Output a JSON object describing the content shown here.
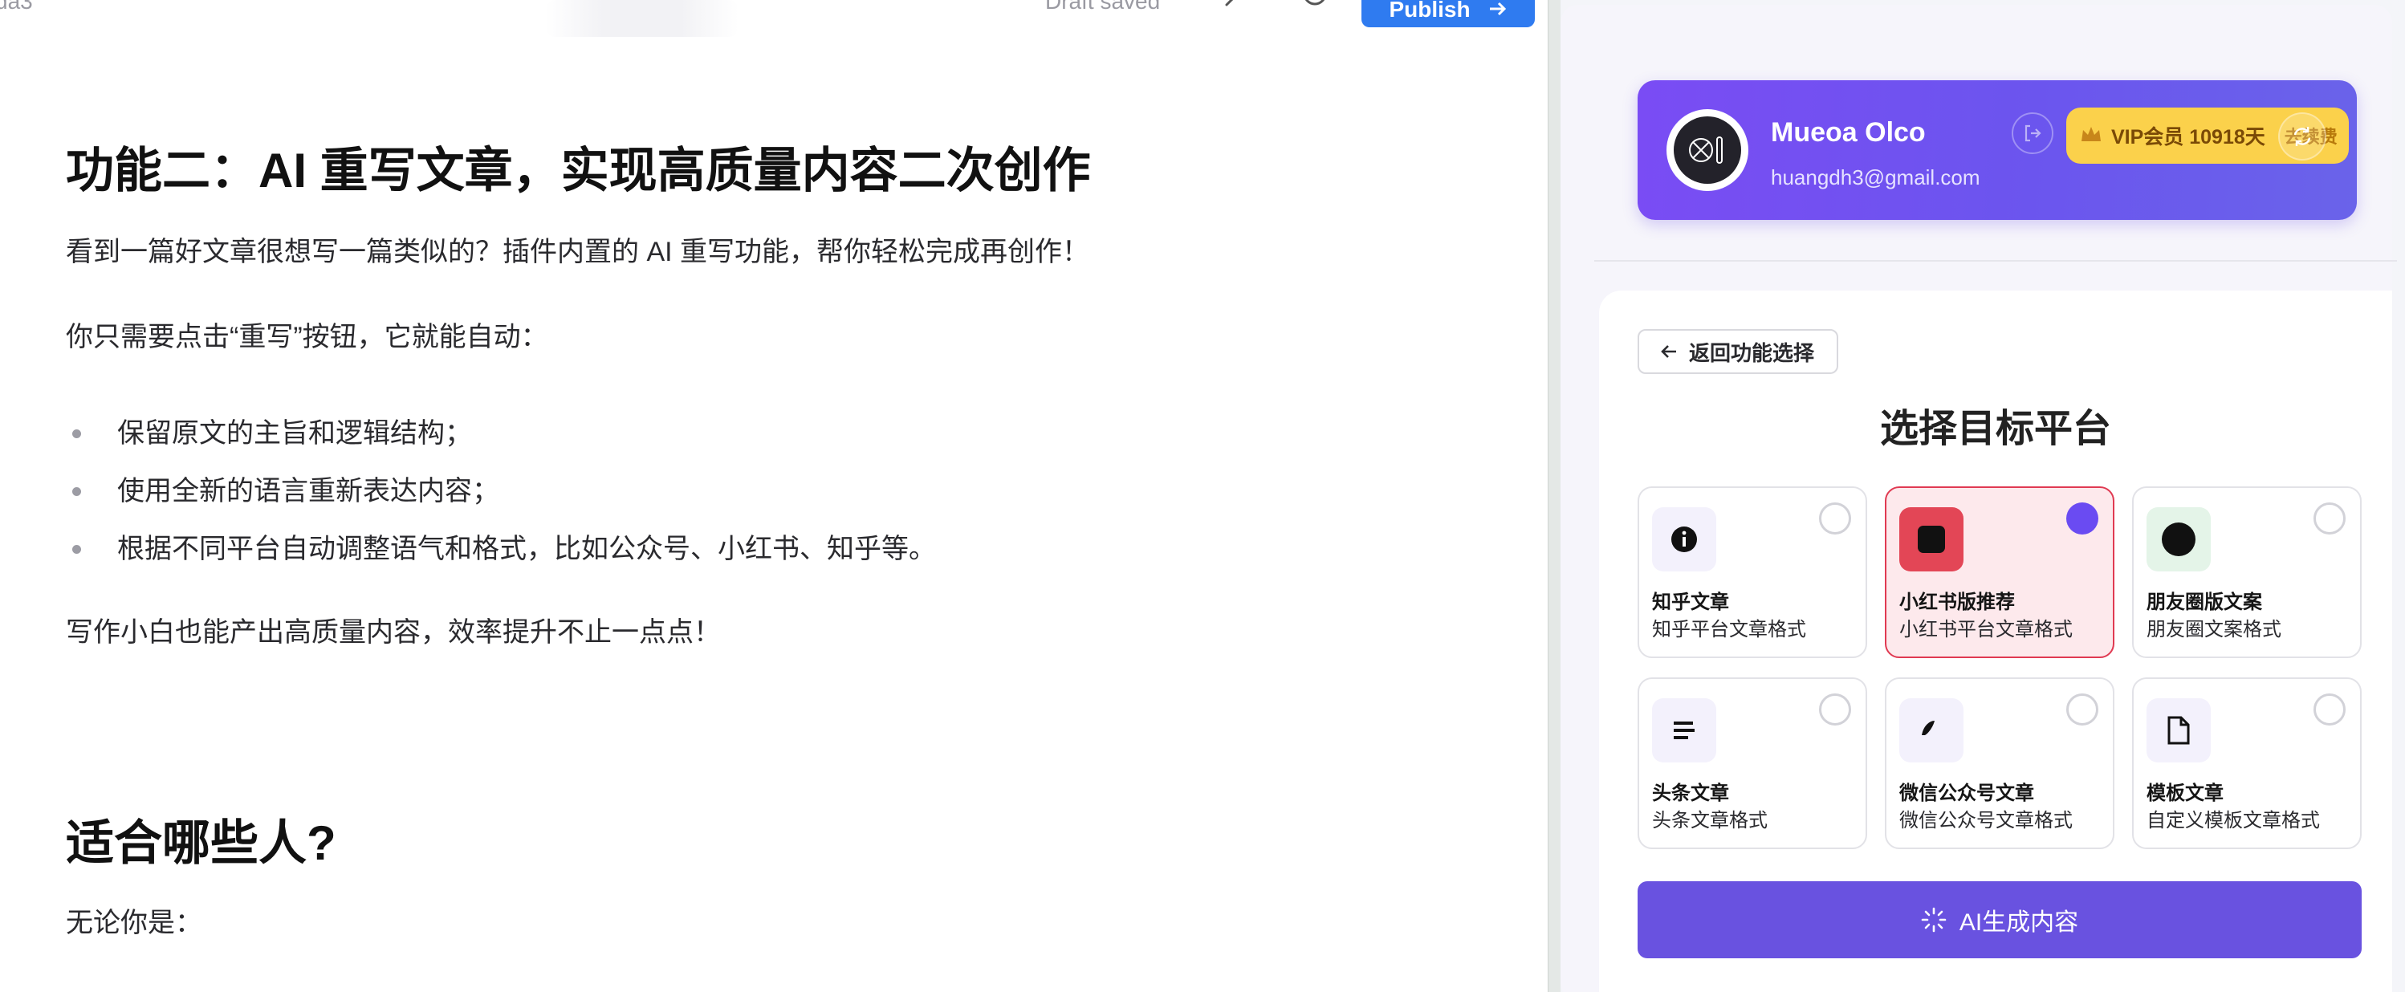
{
  "toolbar": {
    "tab_stub": "da3",
    "draft_status": "Draft saved",
    "publish_label": "Publish"
  },
  "article": {
    "heading1": "功能二：AI 重写文章，实现高质量内容二次创作",
    "para1": "看到一篇好文章很想写一篇类似的？插件内置的 AI 重写功能，帮你轻松完成再创作！",
    "para2": "你只需要点击“重写”按钮，它就能自动：",
    "bullets": [
      "保留原文的主旨和逻辑结构；",
      "使用全新的语言重新表达内容；",
      "根据不同平台自动调整语气和格式，比如公众号、小红书、知乎等。"
    ],
    "para3": "写作小白也能产出高质量内容，效率提升不止一点点！",
    "heading2": "适合哪些人?",
    "para4": "无论你是："
  },
  "user": {
    "name": "Mueoa Olco",
    "email": "huangdh3@gmail.com",
    "vip_label": "VIP会员 10918天",
    "renew_label": "去续费"
  },
  "platform_picker": {
    "back_label": "返回功能选择",
    "title": "选择目标平台",
    "options": [
      {
        "title": "知乎文章",
        "desc": "知乎平台文章格式",
        "icon": "info-icon",
        "selected": false
      },
      {
        "title": "小红书版推荐",
        "desc": "小红书平台文章格式",
        "icon": "square-icon",
        "selected": true
      },
      {
        "title": "朋友圈版文案",
        "desc": "朋友圈文案格式",
        "icon": "circle-icon",
        "selected": false
      },
      {
        "title": "头条文章",
        "desc": "头条文章格式",
        "icon": "text-lines-icon",
        "selected": false
      },
      {
        "title": "微信公众号文章",
        "desc": "微信公众号文章格式",
        "icon": "feather-icon",
        "selected": false
      },
      {
        "title": "模板文章",
        "desc": "自定义模板文章格式",
        "icon": "file-icon",
        "selected": false
      }
    ],
    "generate_label": "AI生成内容"
  },
  "colors": {
    "publish_blue": "#2f7bf0",
    "card_purple": "#6b55ee",
    "vip_yellow": "#fbd14b",
    "selected_red": "#e03a52",
    "radio_on": "#6a4bf2",
    "generate_purple": "#6952e0"
  }
}
